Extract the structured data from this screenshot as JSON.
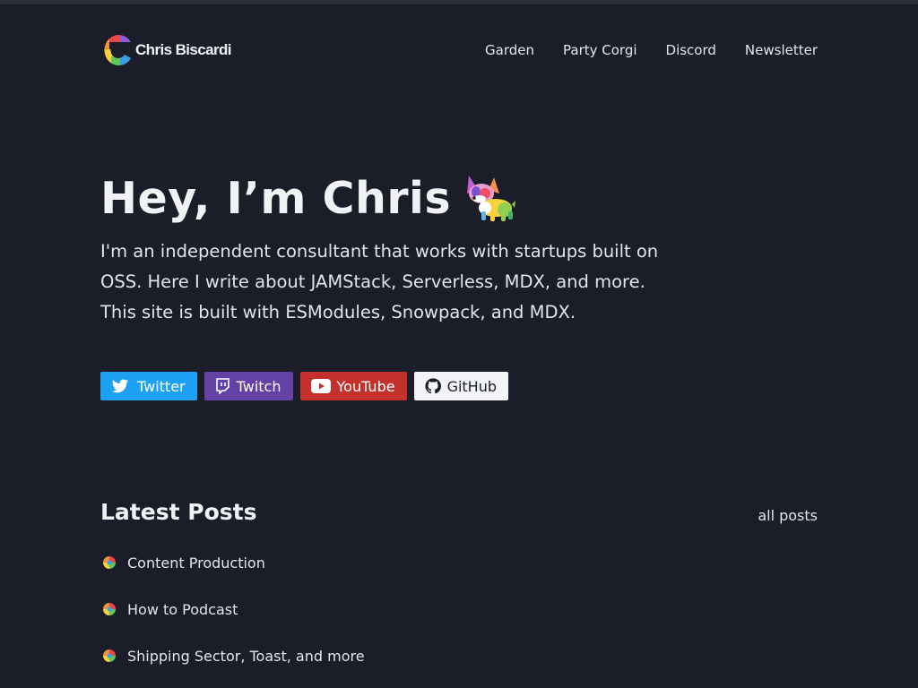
{
  "header": {
    "site_name": "Chris Biscardi",
    "logo_icon": "c-logo-icon",
    "nav": [
      {
        "label": "Garden"
      },
      {
        "label": "Party Corgi"
      },
      {
        "label": "Discord"
      },
      {
        "label": "Newsletter"
      }
    ]
  },
  "hero": {
    "title": "Hey, I’m Chris",
    "title_icon": "party-corgi-icon",
    "intro": "I'm an independent consultant that works with startups built on OSS. Here I write about JAMStack, Serverless, MDX, and more. This site is built with ESModules, Snowpack, and MDX."
  },
  "social": [
    {
      "label": "Twitter",
      "icon": "twitter-icon",
      "color": "#1da1f2"
    },
    {
      "label": "Twitch",
      "icon": "twitch-icon",
      "color": "#6441a4"
    },
    {
      "label": "YouTube",
      "icon": "youtube-icon",
      "color": "#c4302b"
    },
    {
      "label": "GitHub",
      "icon": "github-icon",
      "color": "#f2f4f8"
    }
  ],
  "posts": {
    "heading": "Latest Posts",
    "all_label": "all posts",
    "items": [
      {
        "title": "Content Production"
      },
      {
        "title": "How to Podcast"
      },
      {
        "title": "Shipping Sector, Toast, and more"
      }
    ]
  },
  "colors": {
    "background": "#1b1e28",
    "text": "#e8e9ee"
  }
}
